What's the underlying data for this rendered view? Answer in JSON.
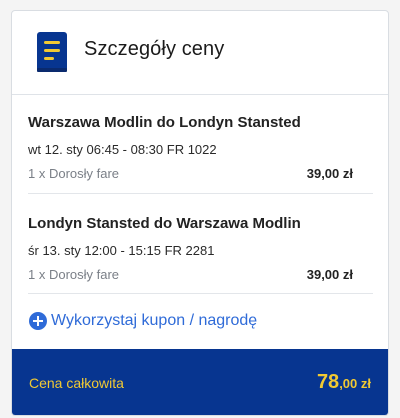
{
  "header": {
    "title": "Szczegóły ceny",
    "icon": "receipt-book-icon"
  },
  "flights": [
    {
      "route": "Warszawa Modlin do Londyn Stansted",
      "times": "wt 12. sty 06:45 - 08:30 FR 1022",
      "fare_label": "1 x Dorosły fare",
      "fare_price": "39,00 zł"
    },
    {
      "route": "Londyn Stansted do Warszawa Modlin",
      "times": "śr 13. sty 12:00 - 15:15 FR 2281",
      "fare_label": "1 x Dorosły fare",
      "fare_price": "39,00 zł"
    }
  ],
  "coupon": {
    "label": "Wykorzystaj kupon / nagrodę",
    "icon": "plus-circle-icon"
  },
  "total": {
    "label": "Cena całkowita",
    "amount_main": "78",
    "amount_decimal": ",00",
    "currency": " zł"
  },
  "colors": {
    "accent_blue": "#2f6bd8",
    "total_bar_bg": "#073590",
    "total_text": "#f1c933",
    "icon_blue": "#073590",
    "icon_yellow": "#f1c933"
  }
}
